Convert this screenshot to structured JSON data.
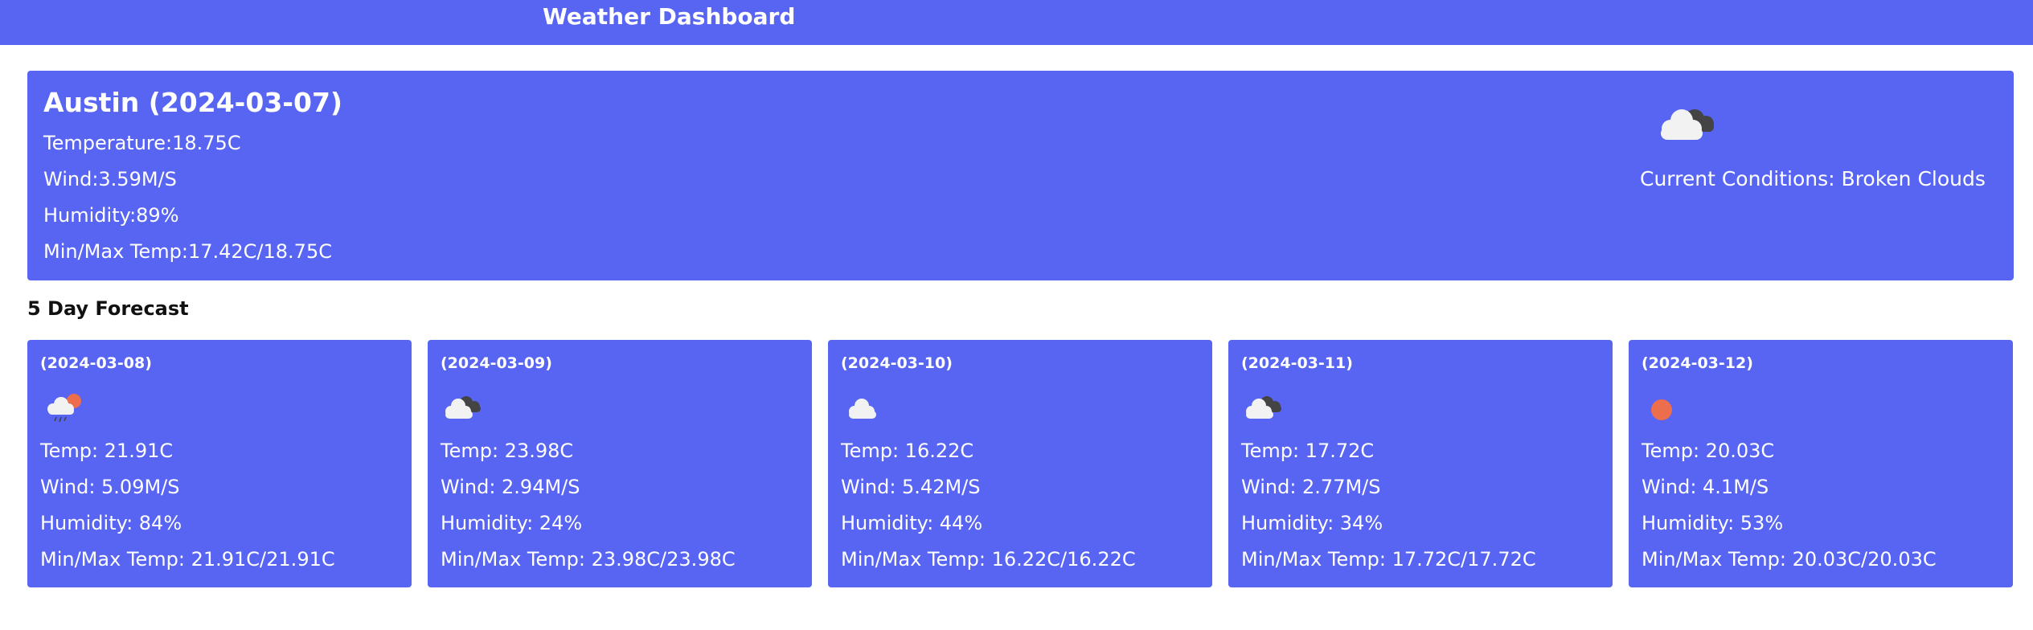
{
  "header": {
    "title": "Weather Dashboard"
  },
  "current": {
    "city_date": "Austin (2024-03-07)",
    "temperature": "Temperature:18.75C",
    "wind": "Wind:3.59M/S",
    "humidity": "Humidity:89%",
    "minmax": "Min/Max Temp:17.42C/18.75C",
    "icon": "broken-clouds-icon",
    "conditions": "Current Conditions: Broken Clouds"
  },
  "forecast": {
    "heading": "5 Day Forecast",
    "days": [
      {
        "date": "(2024-03-08)",
        "icon": "rain-sun-icon",
        "temp": "Temp: 21.91C",
        "wind": "Wind: 5.09M/S",
        "humidity": "Humidity: 84%",
        "minmax": "Min/Max Temp: 21.91C/21.91C"
      },
      {
        "date": "(2024-03-09)",
        "icon": "broken-clouds-icon",
        "temp": "Temp: 23.98C",
        "wind": "Wind: 2.94M/S",
        "humidity": "Humidity: 24%",
        "minmax": "Min/Max Temp: 23.98C/23.98C"
      },
      {
        "date": "(2024-03-10)",
        "icon": "cloud-icon",
        "temp": "Temp: 16.22C",
        "wind": "Wind: 5.42M/S",
        "humidity": "Humidity: 44%",
        "minmax": "Min/Max Temp: 16.22C/16.22C"
      },
      {
        "date": "(2024-03-11)",
        "icon": "broken-clouds-icon",
        "temp": "Temp: 17.72C",
        "wind": "Wind: 2.77M/S",
        "humidity": "Humidity: 34%",
        "minmax": "Min/Max Temp: 17.72C/17.72C"
      },
      {
        "date": "(2024-03-12)",
        "icon": "sun-icon",
        "temp": "Temp: 20.03C",
        "wind": "Wind: 4.1M/S",
        "humidity": "Humidity: 53%",
        "minmax": "Min/Max Temp: 20.03C/20.03C"
      }
    ]
  },
  "colors": {
    "panel": "#5865f2",
    "cloud_light": "#f2f2f2",
    "cloud_dark": "#444444",
    "sun": "#ec6e4c"
  }
}
